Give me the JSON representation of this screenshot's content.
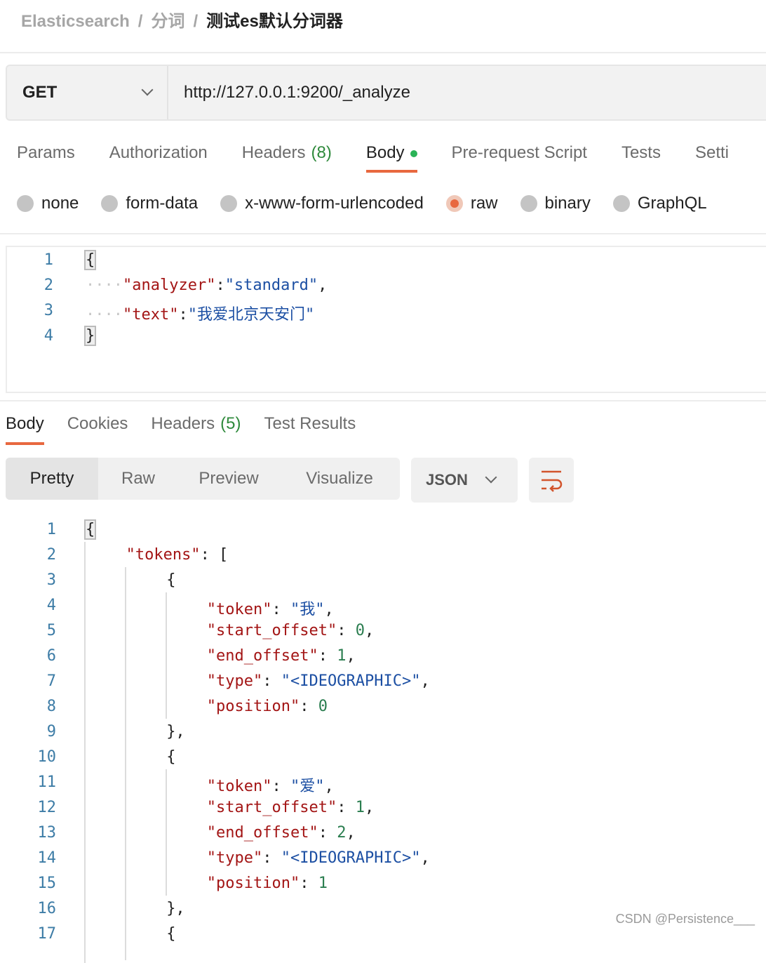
{
  "breadcrumb": {
    "items": [
      "Elasticsearch",
      "分词"
    ],
    "current": "测试es默认分词器",
    "separator": "/"
  },
  "request": {
    "method": "GET",
    "url": "http://127.0.0.1:9200/_analyze"
  },
  "request_tabs": [
    {
      "label": "Params"
    },
    {
      "label": "Authorization"
    },
    {
      "label": "Headers",
      "count": "(8)"
    },
    {
      "label": "Body",
      "active": true,
      "dot": true
    },
    {
      "label": "Pre-request Script"
    },
    {
      "label": "Tests"
    },
    {
      "label": "Setti"
    }
  ],
  "body_types": [
    {
      "label": "none"
    },
    {
      "label": "form-data"
    },
    {
      "label": "x-www-form-urlencoded"
    },
    {
      "label": "raw",
      "selected": true
    },
    {
      "label": "binary"
    },
    {
      "label": "GraphQL"
    }
  ],
  "request_body": [
    [
      [
        "p",
        "{"
      ]
    ],
    [
      [
        "d",
        "····"
      ],
      [
        "k",
        "\"analyzer\""
      ],
      [
        "p",
        ":"
      ],
      [
        "s",
        "\"standard\""
      ],
      [
        "p",
        ","
      ]
    ],
    [
      [
        "d",
        "····"
      ],
      [
        "k",
        "\"text\""
      ],
      [
        "p",
        ":"
      ],
      [
        "s",
        "\"我爱北京天安门\""
      ]
    ],
    [
      [
        "p",
        "}"
      ]
    ]
  ],
  "response_tabs": [
    {
      "label": "Body",
      "active": true
    },
    {
      "label": "Cookies"
    },
    {
      "label": "Headers",
      "count": "(5)"
    },
    {
      "label": "Test Results"
    }
  ],
  "view_modes": [
    {
      "label": "Pretty",
      "active": true
    },
    {
      "label": "Raw"
    },
    {
      "label": "Preview"
    },
    {
      "label": "Visualize"
    }
  ],
  "format": "JSON",
  "response_body": [
    {
      "i": 0,
      "t": [
        [
          "p",
          "{"
        ]
      ]
    },
    {
      "i": 1,
      "t": [
        [
          "k",
          "\"tokens\""
        ],
        [
          "p",
          ": ["
        ]
      ]
    },
    {
      "i": 2,
      "t": [
        [
          "p",
          "{"
        ]
      ]
    },
    {
      "i": 3,
      "t": [
        [
          "k",
          "\"token\""
        ],
        [
          "p",
          ": "
        ],
        [
          "s",
          "\"我\""
        ],
        [
          "p",
          ","
        ]
      ]
    },
    {
      "i": 3,
      "t": [
        [
          "k",
          "\"start_offset\""
        ],
        [
          "p",
          ": "
        ],
        [
          "n",
          "0"
        ],
        [
          "p",
          ","
        ]
      ]
    },
    {
      "i": 3,
      "t": [
        [
          "k",
          "\"end_offset\""
        ],
        [
          "p",
          ": "
        ],
        [
          "n",
          "1"
        ],
        [
          "p",
          ","
        ]
      ]
    },
    {
      "i": 3,
      "t": [
        [
          "k",
          "\"type\""
        ],
        [
          "p",
          ": "
        ],
        [
          "s",
          "\"<IDEOGRAPHIC>\""
        ],
        [
          "p",
          ","
        ]
      ]
    },
    {
      "i": 3,
      "t": [
        [
          "k",
          "\"position\""
        ],
        [
          "p",
          ": "
        ],
        [
          "n",
          "0"
        ]
      ]
    },
    {
      "i": 2,
      "t": [
        [
          "p",
          "},"
        ]
      ]
    },
    {
      "i": 2,
      "t": [
        [
          "p",
          "{"
        ]
      ]
    },
    {
      "i": 3,
      "t": [
        [
          "k",
          "\"token\""
        ],
        [
          "p",
          ": "
        ],
        [
          "s",
          "\"爱\""
        ],
        [
          "p",
          ","
        ]
      ]
    },
    {
      "i": 3,
      "t": [
        [
          "k",
          "\"start_offset\""
        ],
        [
          "p",
          ": "
        ],
        [
          "n",
          "1"
        ],
        [
          "p",
          ","
        ]
      ]
    },
    {
      "i": 3,
      "t": [
        [
          "k",
          "\"end_offset\""
        ],
        [
          "p",
          ": "
        ],
        [
          "n",
          "2"
        ],
        [
          "p",
          ","
        ]
      ]
    },
    {
      "i": 3,
      "t": [
        [
          "k",
          "\"type\""
        ],
        [
          "p",
          ": "
        ],
        [
          "s",
          "\"<IDEOGRAPHIC>\""
        ],
        [
          "p",
          ","
        ]
      ]
    },
    {
      "i": 3,
      "t": [
        [
          "k",
          "\"position\""
        ],
        [
          "p",
          ": "
        ],
        [
          "n",
          "1"
        ]
      ]
    },
    {
      "i": 2,
      "t": [
        [
          "p",
          "},"
        ]
      ]
    },
    {
      "i": 2,
      "t": [
        [
          "p",
          "{"
        ]
      ]
    }
  ],
  "watermark": "CSDN @Persistence___",
  "colors": {
    "accent": "#e8683f",
    "count": "#2f8a3c",
    "key": "#a31515",
    "string": "#1c4fa3",
    "number": "#2a7d4f"
  }
}
